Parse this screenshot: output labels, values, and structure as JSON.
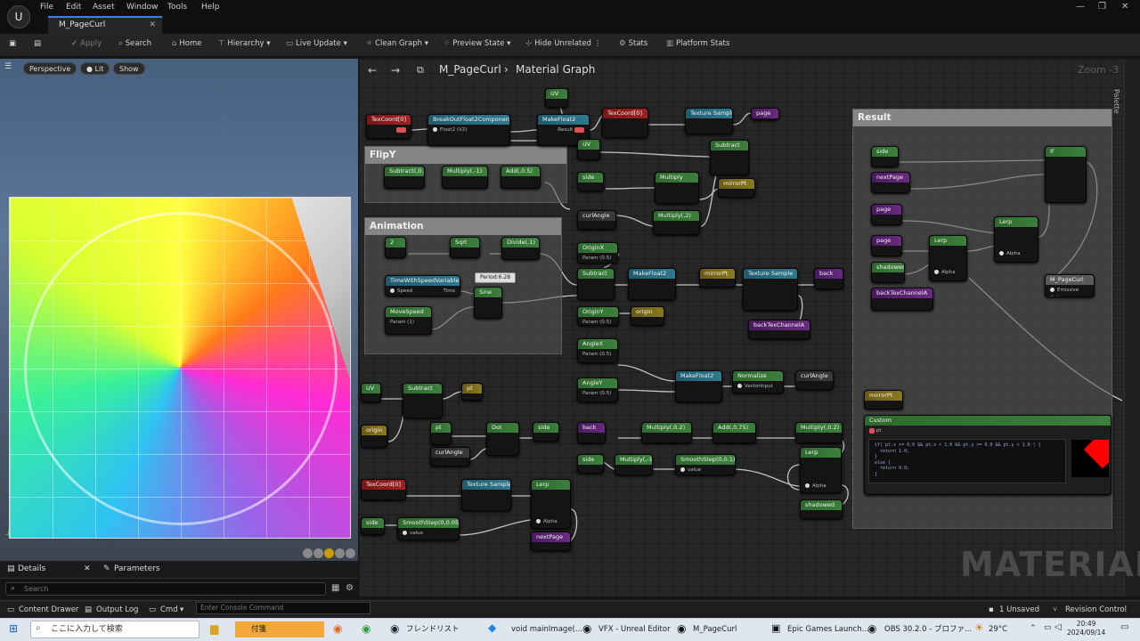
{
  "window": {
    "menus": [
      "File",
      "Edit",
      "Asset",
      "Window",
      "Tools",
      "Help"
    ],
    "tab_title": "M_PageCurl",
    "controls": [
      "—",
      "❐",
      "✕"
    ]
  },
  "toolbar": {
    "apply": "Apply",
    "search": "Search",
    "home": "Home",
    "hierarchy": "Hierarchy",
    "live_update": "Live Update",
    "clean_graph": "Clean Graph",
    "preview_state": "Preview State",
    "hide_unrelated": "Hide Unrelated",
    "stats": "Stats",
    "platform_stats": "Platform Stats"
  },
  "viewport": {
    "perspective": "Perspective",
    "lit": "Lit",
    "show": "Show"
  },
  "details_panel": {
    "details_tab": "Details",
    "parameters_tab": "Parameters",
    "search_placeholder": "Search"
  },
  "graph": {
    "breadcrumb_asset": "M_PageCurl",
    "breadcrumb_graph": "Material Graph",
    "zoom": "Zoom -3",
    "palette": "Palette",
    "watermark": "MATERIAL",
    "comments": {
      "flipy": "FlipY",
      "animation": "Animation",
      "result": "Result"
    },
    "period_note": "Period:6.28",
    "custom_code": "if( pt.x >= 0.0 && pt.x < 1.0 && pt.y >= 0.0 && pt.y < 1.0 ) {\n  return 1.0;\n}\nelse {\n  return 0.0;\n}",
    "nodes": {
      "texcoord_top": "TexCoord[0]",
      "break_float2": "BreakOutFloat2Components",
      "break_out": "Float2 (V2)",
      "uv_top": "UV",
      "make_float2_top": "MakeFloat2",
      "result_label": "Result",
      "texcoord2": "TexCoord[0]",
      "tex_sample_top": "Texture Sample",
      "page_top": "page",
      "uv_mid": "UV",
      "subtract_top": "Subtract",
      "side_1": "side",
      "multiply_1": "Multiply",
      "mirror_pt": "mirrorPt",
      "curl_angle_1": "curlAngle",
      "multiply_2": "Multiply(,2)",
      "subtract_flip": "Subtract(,0.5)",
      "multiply_flip": "Multiply(,-1)",
      "add_flip": "Add(,0.5)",
      "two": "2",
      "sqrt": "Sqrt",
      "divide": "Divide(,1)",
      "time_speed": "TimeWithSpeedVariable",
      "speed": "Speed",
      "time": "Time",
      "move_speed": "MoveSpeed",
      "move_speed_sub": "Param (1)",
      "sine": "Sine",
      "origin_x": "OriginX",
      "origin_x_sub": "Param (0.5)",
      "subtract_mid": "Subtract",
      "make_float2_mid": "MakeFloat2",
      "mirror_pt2": "mirrorPt",
      "tex_sample_mid": "Texture Sample",
      "back_top": "back",
      "origin_y": "OriginY",
      "origin_y_sub": "Param (0.5)",
      "origin": "origin",
      "back_tex_channel": "backTexChannelA",
      "angle_x": "AngleX",
      "angle_x_sub": "Param (0.5)",
      "angle_y": "AngleY",
      "angle_y_sub": "Param (0.5)",
      "make_float2_ang": "MakeFloat2",
      "normalize": "Normalize",
      "vector_input": "VectorInput",
      "curl_angle_out": "curlAngle",
      "uv_bot": "UV",
      "subtract_bot": "Subtract",
      "pt_1": "pt",
      "origin_bot": "origin",
      "pt_2": "pt",
      "dot": "Dot",
      "side_out": "side",
      "curl_angle_bot": "curlAngle",
      "back_bot": "back",
      "multiply_02": "Multiply(,0.2)",
      "add_075": "Add(,0.75)",
      "multiply_02b": "Multiply(,0.2)",
      "side_2": "side",
      "multiply_neg1": "Multiply(,-1)",
      "smoothstep_01": "SmoothStep(0,0.1)",
      "value": "value",
      "lerp_bot": "Lerp",
      "alpha": "Alpha",
      "shadowed_out": "shadowed",
      "texcoord3": "TexCoord[0]",
      "tex_sample_bot": "Texture Sample",
      "lerp_bot2": "Lerp",
      "side_3": "side",
      "smoothstep_005": "SmoothStep(0,0.05)",
      "next_page_out": "nextPage",
      "side_r": "side",
      "next_page_r": "nextPage",
      "page_r": "page",
      "page_r2": "page",
      "shadowed_r": "shadowed",
      "back_tex_r": "backTexChannelA",
      "if_node": "If",
      "lerp_r1": "Lerp",
      "lerp_r2": "Lerp",
      "m_pagecurl": "M_PageCurl",
      "emissive": "Emissive Color",
      "mirror_pt3": "mirrorPt",
      "custom": "Custom",
      "custom_pt": "pt"
    }
  },
  "status": {
    "content_drawer": "Content Drawer",
    "output_log": "Output Log",
    "cmd": "Cmd",
    "console_placeholder": "Enter Console Command",
    "unsaved": "1 Unsaved",
    "revision": "Revision Control"
  },
  "taskbar": {
    "search_placeholder": "ここに入力して検索",
    "apps": [
      "付箋",
      "フレンドリスト",
      "void mainImage(...",
      "VFX - Unreal Editor",
      "M_PageCurl",
      "Epic Games Launch...",
      "OBS 30.2.0 - プロファ..."
    ],
    "temperature": "29°C",
    "time": "20:49",
    "date": "2024/09/14"
  },
  "colors": {
    "accent": "#3d7ff0",
    "graph_bg": "#262626",
    "comment_title": "#858585"
  }
}
